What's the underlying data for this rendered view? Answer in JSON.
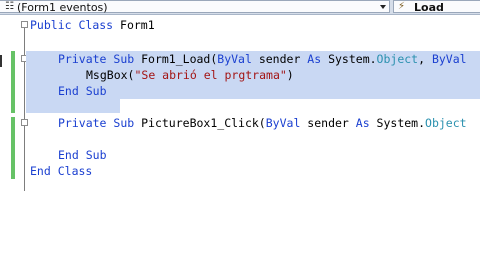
{
  "toolbar": {
    "object_combo_value": "(Form1 eventos)",
    "event_combo_value": "Load"
  },
  "icons": {
    "object_combo": "events-icon",
    "event_combo": "lightning-icon"
  },
  "code": {
    "l1_kw1": "Public",
    "l1_kw2": "Class",
    "l1_name": " Form1",
    "l2_kw1": "Private",
    "l2_kw2": "Sub",
    "l2_name": " Form1_Load(",
    "l2_kw3": "ByVal",
    "l2_p1": " sender ",
    "l2_kw4": "As",
    "l2_p2": " System.",
    "l2_ty1": "Object",
    "l2_p3": ", ",
    "l2_kw5": "ByVal",
    "l3_pre": "MsgBox(",
    "l3_str": "\"Se abrió el prgtrama\"",
    "l3_post": ")",
    "l4_kw1": "End",
    "l4_kw2": "Sub",
    "l5_kw1": "Private",
    "l5_kw2": "Sub",
    "l5_name": " PictureBox1_Click(",
    "l5_kw3": "ByVal",
    "l5_p1": " sender ",
    "l5_kw4": "As",
    "l5_p2": " System.",
    "l5_ty1": "Object",
    "l6_kw1": "End",
    "l6_kw2": "Sub",
    "l7_kw1": "End",
    "l7_kw2": "Class"
  },
  "colors": {
    "keyword": "#1a3fd0",
    "type": "#2b91af",
    "string": "#a31515",
    "selection": "#c9d8f3",
    "change_bar": "#66c266"
  }
}
